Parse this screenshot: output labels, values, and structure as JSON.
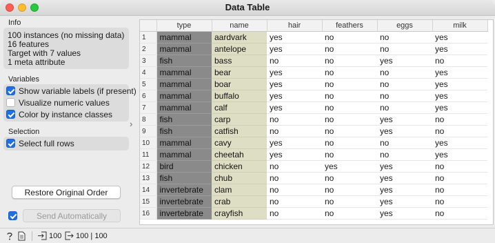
{
  "window": {
    "title": "Data Table"
  },
  "info": {
    "title": "Info",
    "lines": [
      "100 instances (no missing data)",
      "16  features",
      "Target with 7 values",
      "1 meta attribute"
    ]
  },
  "variables": {
    "title": "Variables",
    "show_labels": {
      "label": "Show variable labels (if present)",
      "checked": true
    },
    "visualize_numeric": {
      "label": "Visualize numeric values",
      "checked": false
    },
    "color_by_class": {
      "label": "Color by instance classes",
      "checked": true
    }
  },
  "selection": {
    "title": "Selection",
    "select_full_rows": {
      "label": "Select full rows",
      "checked": true
    }
  },
  "buttons": {
    "restore": "Restore Original Order",
    "send": "Send Automatically"
  },
  "send_auto_checked": true,
  "table": {
    "columns": [
      "type",
      "name",
      "hair",
      "feathers",
      "eggs",
      "milk"
    ],
    "rows": [
      [
        "1",
        "mammal",
        "aardvark",
        "yes",
        "no",
        "no",
        "yes"
      ],
      [
        "2",
        "mammal",
        "antelope",
        "yes",
        "no",
        "no",
        "yes"
      ],
      [
        "3",
        "fish",
        "bass",
        "no",
        "no",
        "yes",
        "no"
      ],
      [
        "4",
        "mammal",
        "bear",
        "yes",
        "no",
        "no",
        "yes"
      ],
      [
        "5",
        "mammal",
        "boar",
        "yes",
        "no",
        "no",
        "yes"
      ],
      [
        "6",
        "mammal",
        "buffalo",
        "yes",
        "no",
        "no",
        "yes"
      ],
      [
        "7",
        "mammal",
        "calf",
        "yes",
        "no",
        "no",
        "yes"
      ],
      [
        "8",
        "fish",
        "carp",
        "no",
        "no",
        "yes",
        "no"
      ],
      [
        "9",
        "fish",
        "catfish",
        "no",
        "no",
        "yes",
        "no"
      ],
      [
        "10",
        "mammal",
        "cavy",
        "yes",
        "no",
        "no",
        "yes"
      ],
      [
        "11",
        "mammal",
        "cheetah",
        "yes",
        "no",
        "no",
        "yes"
      ],
      [
        "12",
        "bird",
        "chicken",
        "no",
        "yes",
        "yes",
        "no"
      ],
      [
        "13",
        "fish",
        "chub",
        "no",
        "no",
        "yes",
        "no"
      ],
      [
        "14",
        "invertebrate",
        "clam",
        "no",
        "no",
        "yes",
        "no"
      ],
      [
        "15",
        "invertebrate",
        "crab",
        "no",
        "no",
        "yes",
        "no"
      ],
      [
        "16",
        "invertebrate",
        "crayfish",
        "no",
        "no",
        "yes",
        "no"
      ]
    ]
  },
  "statusbar": {
    "input_count": "100",
    "output_count": "100 | 100"
  },
  "colors": {
    "accent": "#1f6fe5",
    "type_column": "#8a8a8a",
    "name_column": "#dedec4"
  }
}
